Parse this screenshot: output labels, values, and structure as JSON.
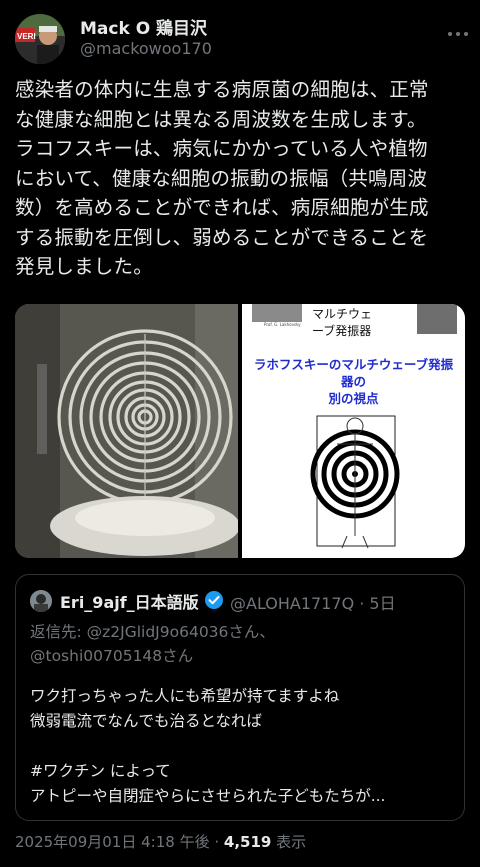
{
  "author": {
    "name": "Mack O 鶏目沢",
    "handle": "@mackowoo170"
  },
  "tweet": {
    "text": "感染者の体内に生息する病原菌の細胞は、正常\nな健康な細胞とは異なる周波数を生成します。\nラコフスキーは、病気にかかっている人や植物\nにおいて、健康な細胞の振動の振幅（共鳴周波\n数）を高めることができれば、病原細胞が生成\nする振動を圧倒し、弱めることができることを\n発見しました。"
  },
  "media": {
    "image2_top": "マルチウェ\nーブ発振器",
    "image2_caption": "Prof. G. Lakhovsky",
    "image2_headline": "ラホフスキーのマルチウェーブ発振\n器の\n別の視点"
  },
  "quote": {
    "name": "Eri_9ajf_日本語版",
    "handle_time": "@ALOHA1717Q · 5日",
    "reply_to": "返信先: @z2JGlidJ9o64036さん、\n@toshi00705148さん",
    "body": "ワク打っちゃった人にも希望が持てますよね\n微弱電流でなんでも治るとなれば\n\n#ワクチン によって\nアトピーや自閉症やらにさせられた子どもたちが..."
  },
  "footer": {
    "timestamp": "2025年09月01日 4:18 午後",
    "separator": " · ",
    "views_count": "4,519",
    "views_label": " 表示"
  },
  "colors": {
    "background": "#000000",
    "text": "#e7e9ea",
    "muted": "#71767b",
    "border": "#2f3336",
    "verified": "#1d9bf0",
    "headline_blue": "#1f2bd0"
  }
}
